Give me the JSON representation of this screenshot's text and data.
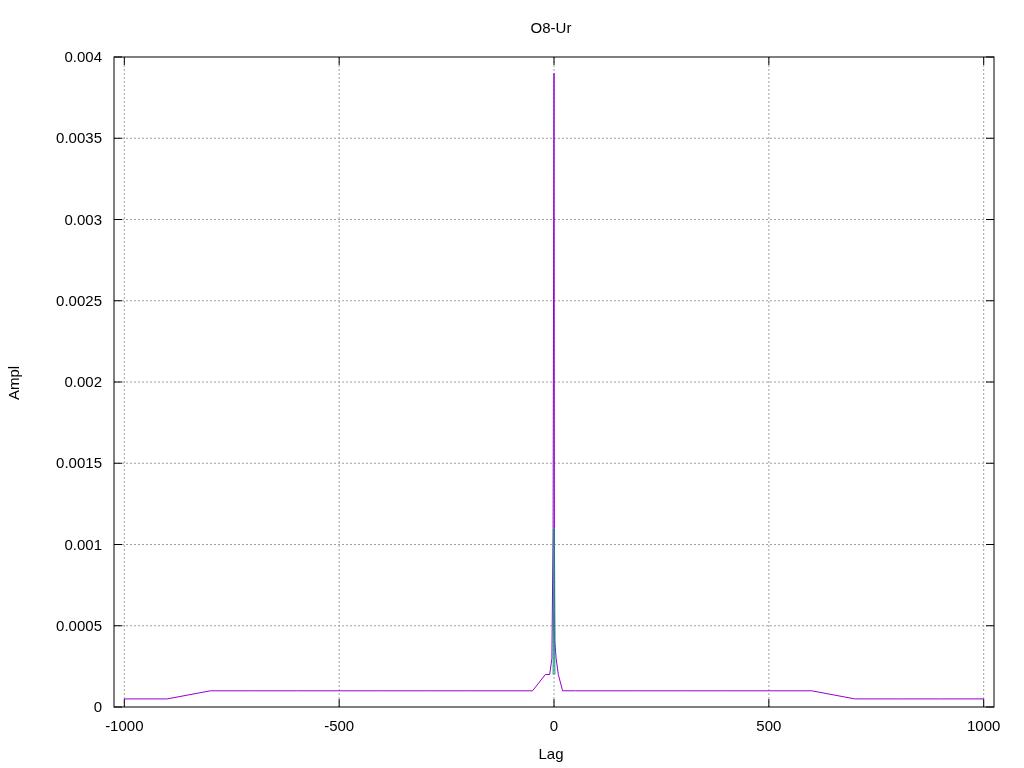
{
  "chart_data": {
    "type": "line",
    "title": "O8-Ur",
    "xlabel": "Lag",
    "ylabel": "Ampl",
    "x": [
      -1000,
      -900,
      -800,
      -700,
      -600,
      -500,
      -400,
      -300,
      -200,
      -100,
      -50,
      -20,
      -10,
      -5,
      -2,
      -1,
      0,
      1,
      2,
      5,
      10,
      20,
      50,
      100,
      200,
      300,
      400,
      500,
      600,
      700,
      800,
      900,
      1000
    ],
    "series": [
      {
        "color": "#9400d3",
        "values": [
          5e-05,
          5e-05,
          0.0001,
          0.0001,
          0.0001,
          0.0001,
          0.0001,
          0.0001,
          0.0001,
          0.0001,
          0.0001,
          0.0002,
          0.0002,
          0.0003,
          0.0011,
          0.0027,
          0.0039,
          0.0011,
          0.0004,
          0.0003,
          0.0002,
          0.0001,
          0.0001,
          0.0001,
          0.0001,
          0.0001,
          0.0001,
          0.0001,
          0.0001,
          5e-05,
          5e-05,
          5e-05,
          5e-05
        ]
      },
      {
        "color": "#009e73",
        "values": [
          null,
          null,
          null,
          null,
          null,
          null,
          null,
          null,
          null,
          null,
          null,
          null,
          null,
          null,
          0.0002,
          0.0006,
          0.0011,
          0.0006,
          0.0002,
          null,
          null,
          null,
          null,
          null,
          null,
          null,
          null,
          null,
          null,
          null,
          null,
          null,
          null
        ]
      }
    ],
    "grid": true,
    "xlim": [
      -1024,
      1024
    ],
    "ylim": [
      0,
      0.004
    ],
    "xticks": [
      {
        "value": -1000,
        "label": "-1000"
      },
      {
        "value": -500,
        "label": "-500"
      },
      {
        "value": 0,
        "label": "0"
      },
      {
        "value": 500,
        "label": "500"
      },
      {
        "value": 1000,
        "label": "1000"
      }
    ],
    "yticks": [
      {
        "value": 0,
        "label": "0"
      },
      {
        "value": 0.0005,
        "label": "0.0005"
      },
      {
        "value": 0.001,
        "label": "0.001"
      },
      {
        "value": 0.0015,
        "label": "0.0015"
      },
      {
        "value": 0.002,
        "label": "0.002"
      },
      {
        "value": 0.0025,
        "label": "0.0025"
      },
      {
        "value": 0.003,
        "label": "0.003"
      },
      {
        "value": 0.0035,
        "label": "0.0035"
      },
      {
        "value": 0.004,
        "label": "0.004"
      }
    ]
  }
}
